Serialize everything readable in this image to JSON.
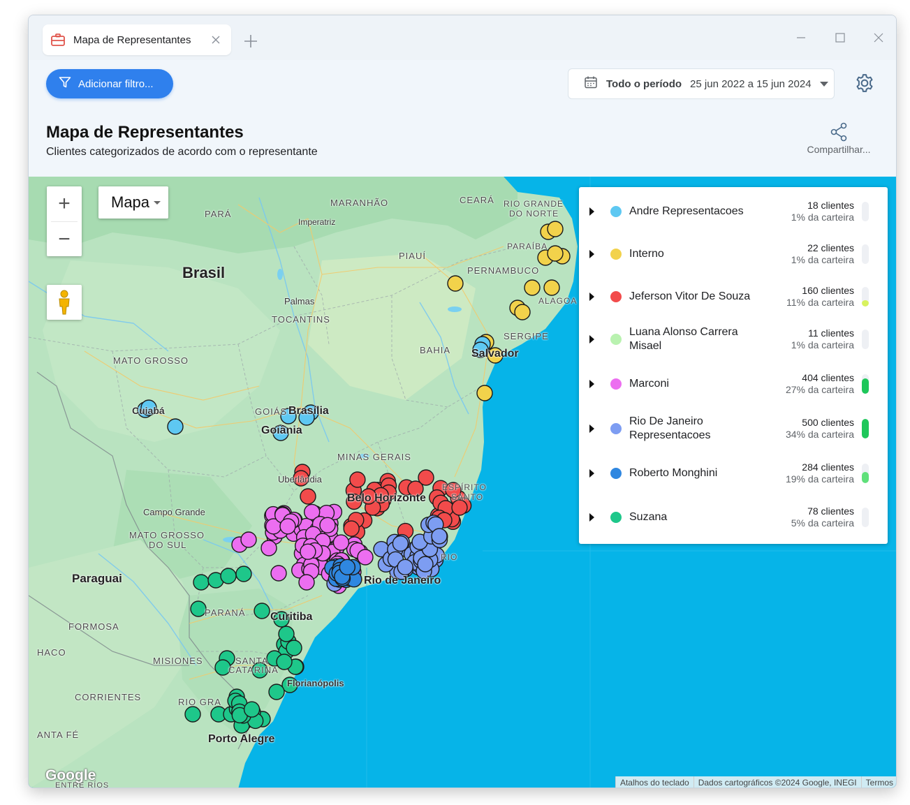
{
  "tab": {
    "title": "Mapa de Representantes",
    "icon": "briefcase-icon"
  },
  "toolbar": {
    "filter_label": "Adicionar filtro...",
    "period_label": "Todo o período",
    "date_range": "25 jun 2022 a 15 jun 2024"
  },
  "header": {
    "title": "Mapa de Representantes",
    "subtitle": "Clientes categorizados de acordo com o representante",
    "share_label": "Compartilhar..."
  },
  "map": {
    "type_label": "Mapa",
    "zoom_in": "+",
    "zoom_out": "−",
    "logo": "Google",
    "attribution": [
      "Atalhos do teclado",
      "Dados cartográficos ©2024 Google, INEGI",
      "Termos"
    ],
    "labels": {
      "para": "PARÁ",
      "maranhao": "MARANHÃO",
      "imperatriz": "Imperatriz",
      "ceara": "CEARÁ",
      "rio_grande_do_norte_1": "RIO GRANDE",
      "rio_grande_do_norte_2": "DO NORTE",
      "paraiba": "PARAÍBA",
      "piaui": "PIAUÍ",
      "pernambuco": "PERNAMBUCO",
      "brasil": "Brasil",
      "alagoas": "ALAGOA",
      "palmas": "Palmas",
      "tocantins": "TOCANTINS",
      "sergipe": "SERGIPE",
      "bahia": "BAHIA",
      "salvador": "Salvador",
      "mato_grosso": "MATO GROSSO",
      "cuiaba": "Cuiabá",
      "goias": "GOIÁS",
      "brasilia": "Brasília",
      "goiania": "Goiânia",
      "minas_gerais": "MINAS GERAIS",
      "uberlandia": "Uberlândia",
      "belo_horizonte": "Belo Horizonte",
      "espirito_santo_1": "ESPÍRITO",
      "espirito_santo_2": "SANTO",
      "campo_grande": "Campo Grande",
      "mato_grosso_do_sul_1": "MATO GROSSO",
      "mato_grosso_do_sul_2": "DO SUL",
      "paraguai": "Paraguai",
      "rio_de_janeiro": "Rio de Janeiro",
      "rio_de_janeiro_state": "RIO",
      "parana": "PARANÁ",
      "curitiba": "Curitiba",
      "formosa": "FORMOSA",
      "chaco": "HACO",
      "misiones": "MISIONES",
      "santa_catarina": "SANTA",
      "catarina": "CATARINA",
      "florianopolis": "Florianópolis",
      "corrientes": "CORRIENTES",
      "rio_grande_do_sul": "RIO GRA",
      "porto_alegre": "Porto Alegre",
      "santa_fe": "ANTA FÉ",
      "entre_rios": "ENTRE RÍOS"
    }
  },
  "legend": [
    {
      "name": "Andre Representacoes",
      "count": "18 clientes",
      "pct": "1% da carteira",
      "share": 0.01,
      "color": "#5ec8f2"
    },
    {
      "name": "Interno",
      "count": "22 clientes",
      "pct": "1% da carteira",
      "share": 0.01,
      "color": "#f2d24b"
    },
    {
      "name": "Jeferson Vitor De Souza",
      "count": "160 clientes",
      "pct": "11% da carteira",
      "share": 0.11,
      "color": "#f24b4b"
    },
    {
      "name": "Luana Alonso Carrera Misael",
      "count": "11 clientes",
      "pct": "1% da carteira",
      "share": 0.01,
      "color": "#b9f2b0"
    },
    {
      "name": "Marconi",
      "count": "404 clientes",
      "pct": "27% da carteira",
      "share": 0.27,
      "color": "#ec6ef0"
    },
    {
      "name": "Rio De Janeiro Representacoes",
      "count": "500 clientes",
      "pct": "34% da carteira",
      "share": 0.34,
      "color": "#7d9df2"
    },
    {
      "name": "Roberto Monghini",
      "count": "284 clientes",
      "pct": "19% da carteira",
      "share": 0.19,
      "color": "#2f87e0"
    },
    {
      "name": "Suzana",
      "count": "78 clientes",
      "pct": "5% da carteira",
      "share": 0.05,
      "color": "#1ec78a"
    }
  ]
}
